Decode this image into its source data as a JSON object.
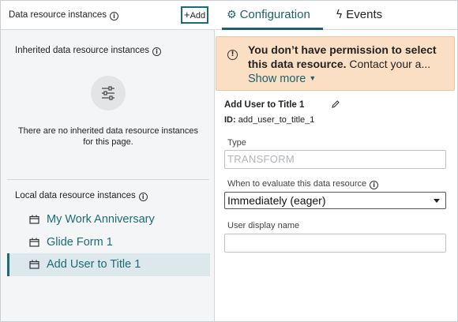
{
  "left_panel": {
    "header_title": "Data resource instances",
    "add_label": "Add",
    "inherited": {
      "title": "Inherited data resource instances",
      "empty_text": "There are no inherited data resource instances for this page."
    },
    "local": {
      "title": "Local data resource instances",
      "items": [
        {
          "label": "My Work Anniversary",
          "selected": false
        },
        {
          "label": "Glide Form 1",
          "selected": false
        },
        {
          "label": "Add User to Title 1",
          "selected": true
        }
      ]
    }
  },
  "right_panel": {
    "tabs": [
      {
        "label": "Configuration",
        "icon": "gear-icon",
        "active": true
      },
      {
        "label": "Events",
        "icon": "lightning-icon",
        "active": false
      }
    ],
    "warning": {
      "bold_text": "You don’t have permission to select this data resource.",
      "rest_text": " Contact your a...",
      "show_more": "Show more"
    },
    "detail": {
      "title": "Add User to Title 1",
      "id_label": "ID:",
      "id_value": "add_user_to_title_1"
    },
    "fields": {
      "type_label": "Type",
      "type_value": "TRANSFORM",
      "evaluate_label": "When to evaluate this data resource",
      "evaluate_value": "Immediately (eager)",
      "display_name_label": "User display name",
      "display_name_value": ""
    }
  },
  "colors": {
    "accent": "#1d6b78",
    "warning_bg": "#fbdfc4",
    "selected_bg": "#dde8ec"
  }
}
